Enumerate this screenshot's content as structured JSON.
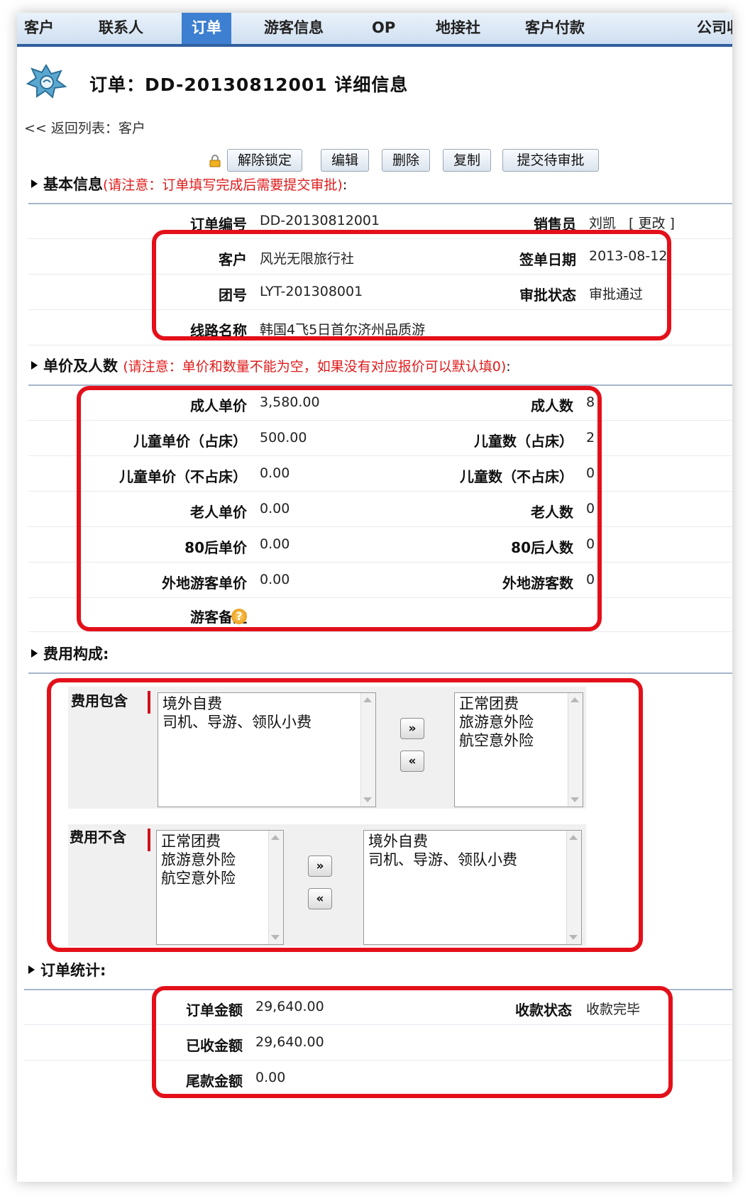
{
  "nav": {
    "items": [
      "客户",
      "联系人",
      "订单",
      "游客信息",
      "OP",
      "地接社",
      "客户付款",
      "公司收"
    ],
    "active_index": 2
  },
  "header": {
    "title": "订单：DD-20130812001 详细信息",
    "back_link": "<< 返回列表：客户"
  },
  "toolbar": {
    "unlock": "解除锁定",
    "edit": "编辑",
    "delete": "删除",
    "copy": "复制",
    "submit": "提交待审批"
  },
  "basic": {
    "heading": "基本信息",
    "note": "(请注意：订单填写完成后需要提交审批)",
    "colon": ":",
    "order_no_label": "订单编号",
    "order_no": "DD-20130812001",
    "sales_label": "销售员",
    "sales": "刘凯",
    "change_link": "[ 更改 ]",
    "customer_label": "客户",
    "customer": "风光无限旅行社",
    "sign_date_label": "签单日期",
    "sign_date": "2013-08-12",
    "group_label": "团号",
    "group": "LYT-201308001",
    "approval_label": "审批状态",
    "approval": "审批通过",
    "route_label": "线路名称",
    "route": "韩国4飞5日首尔济州品质游"
  },
  "pricing": {
    "heading": "单价及人数",
    "note": "(请注意：单价和数量不能为空，如果没有对应报价可以默认填0)",
    "colon": ":",
    "rows": [
      {
        "price_label": "成人单价",
        "price": "3,580.00",
        "count_label": "成人数",
        "count": "8"
      },
      {
        "price_label": "儿童单价（占床）",
        "price": "500.00",
        "count_label": "儿童数（占床）",
        "count": "2"
      },
      {
        "price_label": "儿童单价（不占床）",
        "price": "0.00",
        "count_label": "儿童数（不占床）",
        "count": "0"
      },
      {
        "price_label": "老人单价",
        "price": "0.00",
        "count_label": "老人数",
        "count": "0"
      },
      {
        "price_label": "80后单价",
        "price": "0.00",
        "count_label": "80后人数",
        "count": "0"
      },
      {
        "price_label": "外地游客单价",
        "price": "0.00",
        "count_label": "外地游客数",
        "count": "0"
      }
    ],
    "remark_label": "游客备注",
    "help_glyph": "?"
  },
  "fees": {
    "heading": "费用构成:",
    "included_label": "费用包含",
    "included_left": [
      "境外自费",
      "司机、导游、领队小费"
    ],
    "included_right": [
      "正常团费",
      "旅游意外险",
      "航空意外险"
    ],
    "excluded_label": "费用不含",
    "excluded_left": [
      "正常团费",
      "旅游意外险",
      "航空意外险"
    ],
    "excluded_right": [
      "境外自费",
      "司机、导游、领队小费"
    ],
    "move_right": "»",
    "move_left": "«"
  },
  "stats": {
    "heading": "订单统计:",
    "total_label": "订单金额",
    "total": "29,640.00",
    "pay_status_label": "收款状态",
    "pay_status": "收款完毕",
    "received_label": "已收金额",
    "received": "29,640.00",
    "balance_label": "尾款金额",
    "balance": "0.00"
  },
  "colors": {
    "accent": "#3d7fd1",
    "highlight": "#e3101a",
    "note": "#e01b1b"
  }
}
